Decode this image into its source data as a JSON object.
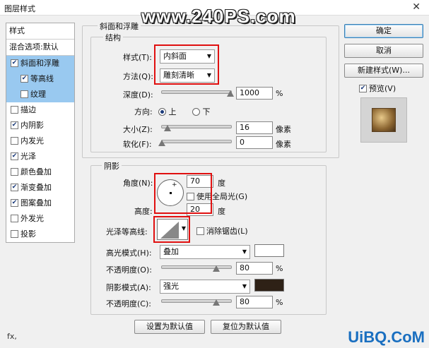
{
  "window": {
    "title": "图层样式",
    "watermark": "www.240PS.com"
  },
  "left_list": {
    "header": "样式",
    "blend_options": "混合选项:默认",
    "items": [
      {
        "label": "斜面和浮雕",
        "checked": true,
        "selected": true
      },
      {
        "label": "等高线",
        "checked": true,
        "selected": true,
        "sub": true
      },
      {
        "label": "纹理",
        "checked": false,
        "selected": true,
        "sub": true
      },
      {
        "label": "描边",
        "checked": false
      },
      {
        "label": "内阴影",
        "checked": true
      },
      {
        "label": "内发光",
        "checked": false
      },
      {
        "label": "光泽",
        "checked": true
      },
      {
        "label": "颜色叠加",
        "checked": false
      },
      {
        "label": "渐变叠加",
        "checked": true
      },
      {
        "label": "图案叠加",
        "checked": true
      },
      {
        "label": "外发光",
        "checked": false
      },
      {
        "label": "投影",
        "checked": false
      }
    ],
    "fx_label": "fx,"
  },
  "bevel": {
    "group_title": "斜面和浮雕",
    "structure_title": "结构",
    "style_label": "样式(T):",
    "style_value": "内斜面",
    "technique_label": "方法(Q):",
    "technique_value": "雕刻清晰",
    "depth_label": "深度(D):",
    "depth_value": "1000",
    "depth_unit": "%",
    "direction_label": "方向:",
    "dir_up": "上",
    "dir_down": "下",
    "size_label": "大小(Z):",
    "size_value": "16",
    "size_unit": "像素",
    "soften_label": "软化(F):",
    "soften_value": "0",
    "soften_unit": "像素"
  },
  "shading": {
    "title": "阴影",
    "angle_label": "角度(N):",
    "angle_value": "70",
    "angle_unit": "度",
    "global_light_label": "使用全局光(G)",
    "altitude_label": "高度:",
    "altitude_value": "20",
    "altitude_unit": "度",
    "gloss_contour_label": "光泽等高线:",
    "antialias_label": "消除锯齿(L)",
    "highlight_mode_label": "高光模式(H):",
    "highlight_mode_value": "叠加",
    "highlight_color": "#ffffff",
    "highlight_opacity_label": "不透明度(O):",
    "highlight_opacity_value": "80",
    "highlight_opacity_unit": "%",
    "shadow_mode_label": "阴影模式(A):",
    "shadow_mode_value": "强光",
    "shadow_color": "#2e2116",
    "shadow_opacity_label": "不透明度(C):",
    "shadow_opacity_value": "80",
    "shadow_opacity_unit": "%"
  },
  "footer": {
    "make_default": "设置为默认值",
    "reset_default": "复位为默认值"
  },
  "right": {
    "ok": "确定",
    "cancel": "取消",
    "new_style": "新建样式(W)...",
    "preview_label": "预览(V)"
  },
  "logo": "UiBQ.CoM"
}
